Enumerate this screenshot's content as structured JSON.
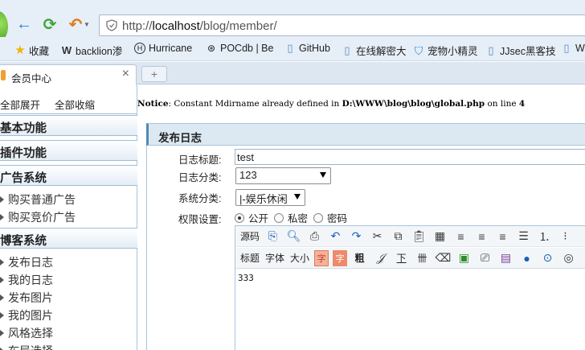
{
  "browser": {
    "url_prefix": "http://",
    "url_host": "localhost",
    "url_path": "/blog/member/",
    "bookmarks": [
      {
        "label": "收藏",
        "icon": "star-icon"
      },
      {
        "label": "backlion渗",
        "icon": "w-logo-icon"
      },
      {
        "label": "Hurricane",
        "icon": "he-logo-icon"
      },
      {
        "label": "POCdb | Be",
        "icon": "poc-logo-icon"
      },
      {
        "label": "GitHub",
        "icon": "page-icon"
      },
      {
        "label": "在线解密大",
        "icon": "page-icon"
      },
      {
        "label": "宠物小精灵",
        "icon": "shield-icon"
      },
      {
        "label": "JJsec黑客技",
        "icon": "page-icon"
      },
      {
        "label": "W",
        "icon": "page-icon"
      }
    ],
    "tab": {
      "title": "会员中心",
      "close": "×"
    },
    "newtab": "+"
  },
  "sidebar": {
    "expand_all": "全部展开",
    "collapse_all": "全部收缩",
    "sections": [
      {
        "title": "基本功能",
        "items": []
      },
      {
        "title": "插件功能",
        "items": []
      },
      {
        "title": "广告系统",
        "items": [
          "购买普通广告",
          "购买竞价广告"
        ]
      },
      {
        "title": "博客系统",
        "items": [
          "发布日志",
          "我的日志",
          "发布图片",
          "我的图片",
          "风格选择",
          "布局选择"
        ]
      }
    ]
  },
  "notice": {
    "label": "Notice",
    "message": ": Constant Mdirname already defined in ",
    "path": "D:\\WWW\\blog\\blog\\global.php",
    "line_text": " on line ",
    "line": "4"
  },
  "form": {
    "heading": "发布日志",
    "title_label": "日志标题:",
    "title_value": "test",
    "category_label": "日志分类:",
    "category_value": "123",
    "system_label": "系统分类:",
    "system_value": "|-娱乐休闲",
    "privacy_label": "权限设置:",
    "privacy_options": [
      "公开",
      "私密",
      "密码"
    ],
    "privacy_selected": "公开"
  },
  "editor": {
    "toolbar1": {
      "source": "源码"
    },
    "toolbar2": {
      "heading": "标题",
      "font": "字体",
      "size": "大小",
      "fontcolor": "字",
      "bgcolor": "字",
      "bold": "粗",
      "underline": "下",
      "table": "卌"
    },
    "content": "333"
  },
  "colors": {
    "accent": "#4f8ab5",
    "panel_bg": "#dce9f3"
  }
}
